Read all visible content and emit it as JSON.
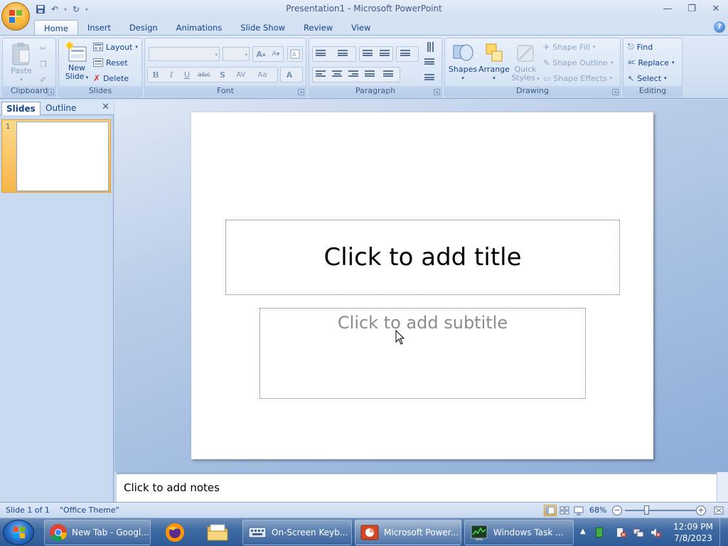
{
  "app": {
    "window_title": "Presentation1 - Microsoft PowerPoint"
  },
  "ribbon": {
    "tabs": [
      {
        "label": "Home",
        "active": true
      },
      {
        "label": "Insert"
      },
      {
        "label": "Design"
      },
      {
        "label": "Animations"
      },
      {
        "label": "Slide Show"
      },
      {
        "label": "Review"
      },
      {
        "label": "View"
      }
    ],
    "clipboard": {
      "label": "Clipboard",
      "paste": "Paste"
    },
    "slides": {
      "label": "Slides",
      "new_slide_line1": "New",
      "new_slide_line2": "Slide",
      "layout": "Layout",
      "reset": "Reset",
      "delete": "Delete"
    },
    "font": {
      "label": "Font"
    },
    "paragraph": {
      "label": "Paragraph"
    },
    "drawing": {
      "label": "Drawing",
      "shapes": "Shapes",
      "arrange": "Arrange",
      "quick_styles_1": "Quick",
      "quick_styles_2": "Styles",
      "shape_fill": "Shape Fill",
      "shape_outline": "Shape Outline",
      "shape_effects": "Shape Effects"
    },
    "editing": {
      "label": "Editing",
      "find": "Find",
      "replace": "Replace",
      "select": "Select"
    }
  },
  "panel": {
    "tab_slides": "Slides",
    "tab_outline": "Outline",
    "slide_number": "1"
  },
  "slide": {
    "title_placeholder": "Click to add title",
    "subtitle_placeholder": "Click to add subtitle"
  },
  "notes": {
    "placeholder": "Click to add notes"
  },
  "status": {
    "slide_info": "Slide 1 of 1",
    "theme": "\"Office Theme\"",
    "zoom": "68%",
    "zoom_level": 0.68
  },
  "taskbar": {
    "items": [
      {
        "label": "New Tab - Googl...",
        "icon": "chrome-icon"
      },
      {
        "label": "On-Screen Keyb...",
        "icon": "keyboard-icon"
      },
      {
        "label": "Microsoft Power...",
        "icon": "powerpoint-icon"
      },
      {
        "label": "Windows Task ...",
        "icon": "task-manager-icon"
      }
    ],
    "clock_time": "12:09 PM",
    "clock_date": "7/8/2023"
  },
  "colors": {
    "ribbon_text": "#15428b",
    "accent_orange": "#f7b548"
  }
}
